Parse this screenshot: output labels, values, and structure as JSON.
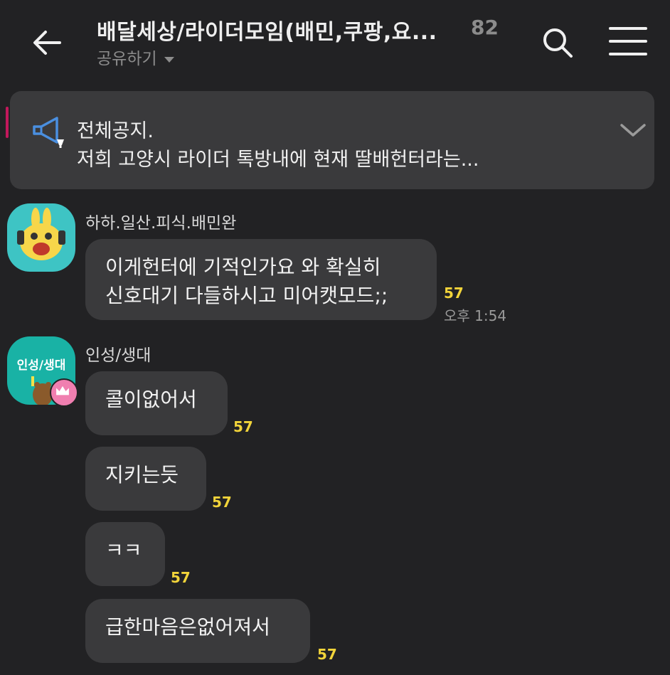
{
  "header": {
    "title": "배달세상/라이더모임(배민,쿠팡,요...",
    "member_count": "82",
    "share_label": "공유하기",
    "icons": {
      "back": "back-arrow-icon",
      "search": "search-icon",
      "menu": "hamburger-menu-icon"
    }
  },
  "notice": {
    "icon": "megaphone-icon",
    "title": "전체공지.",
    "preview": "저희 고양시 라이더 톡방내에 현재 딸배헌터라는..."
  },
  "messages": [
    {
      "sender": "하하.일산.피식.배민완",
      "bubbles": [
        {
          "lines": [
            "이게헌터에 기적인가요 와 확실히",
            "신호대기 다들하시고 미어캣모드;;"
          ],
          "unread": "57",
          "time": "오후 1:54"
        }
      ]
    },
    {
      "sender": "인성/생대",
      "avatar_text": "인성/생대",
      "badge": "crown-icon",
      "bubbles": [
        {
          "text": "콜이없어서",
          "unread": "57"
        },
        {
          "text": "지키는듯",
          "unread": "57"
        },
        {
          "text": "ㅋㅋ",
          "unread": "57"
        },
        {
          "text": "급한마음은없어져서",
          "unread": "57"
        }
      ]
    }
  ],
  "colors": {
    "background": "#222224",
    "bubble": "#3a3a3c",
    "unread": "#f2d43a",
    "muted": "#8c8c8c",
    "notice_icon": "#4a8fe0"
  }
}
